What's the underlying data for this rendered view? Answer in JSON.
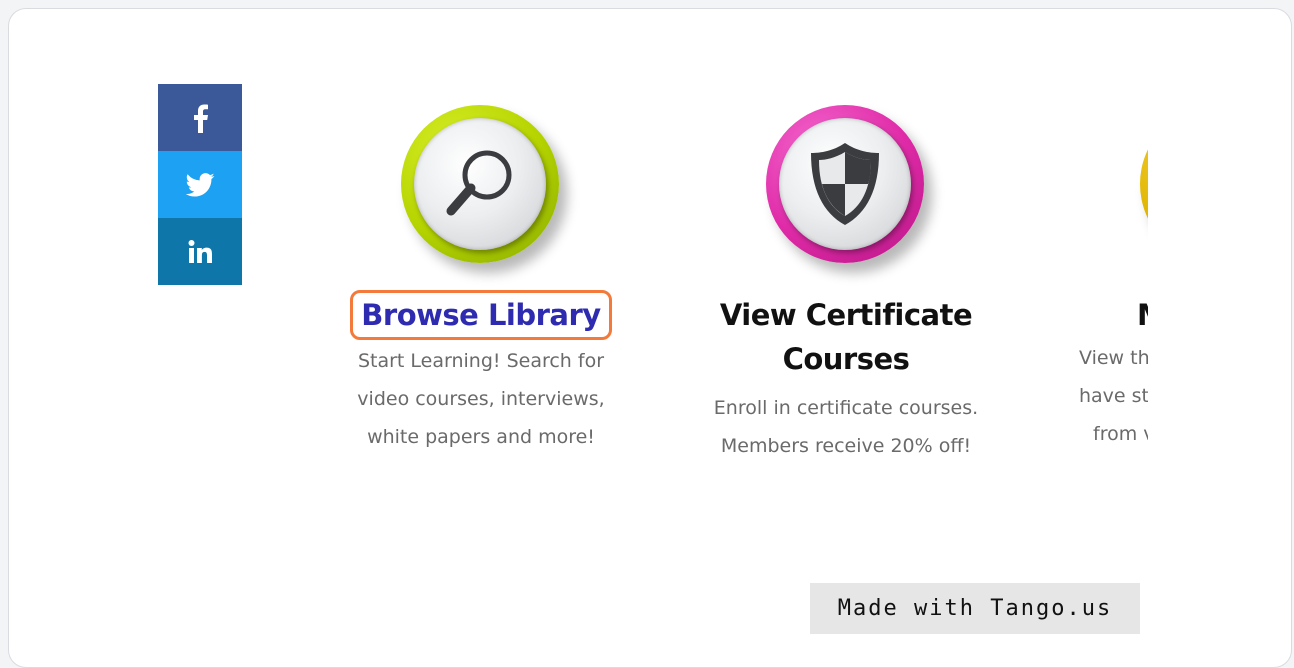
{
  "share": {
    "facebook_color": "#3b5998",
    "twitter_color": "#1da1f2",
    "linkedin_color": "#0e76a8",
    "items": [
      {
        "name": "facebook",
        "icon": "facebook-icon"
      },
      {
        "name": "twitter",
        "icon": "twitter-icon"
      },
      {
        "name": "linkedin",
        "icon": "linkedin-icon"
      }
    ]
  },
  "cards": [
    {
      "title": "Browse Library",
      "desc_lines": [
        "Start Learning! Search for",
        "video courses, interviews,",
        "white papers and more!"
      ],
      "icon": "magnifier-icon",
      "ring_color": "#b6d400"
    },
    {
      "title_lines": [
        "View Certificate",
        "Courses"
      ],
      "desc_lines": [
        "Enroll in certificate courses.",
        "Members receive 20% off!"
      ],
      "icon": "shield-icon",
      "ring_color": "#e02ba8"
    },
    {
      "title": "M",
      "desc_lines": [
        "View th",
        "have st",
        "from v"
      ],
      "icon": "partial-badge-icon",
      "ring_color": "#e0b400"
    }
  ],
  "highlight_color": "#f47a3c",
  "link_color": "#2e2bb0",
  "watermark": "Made with Tango.us"
}
